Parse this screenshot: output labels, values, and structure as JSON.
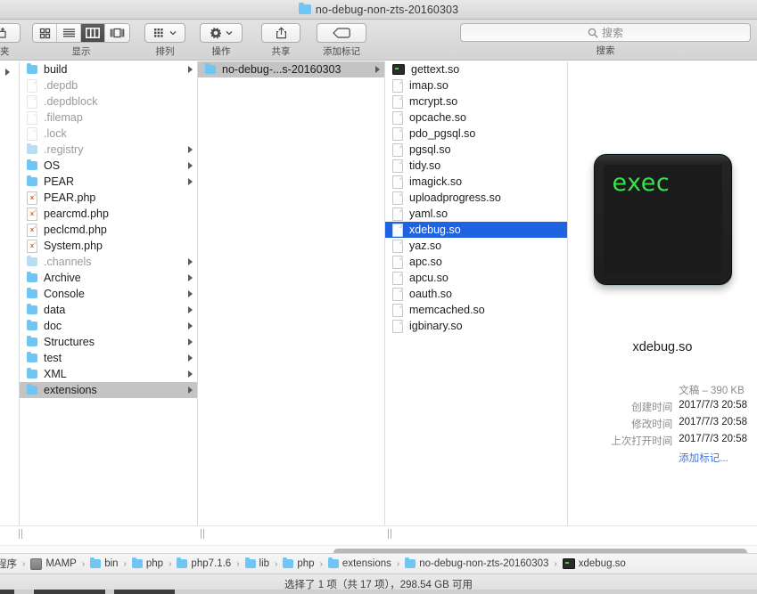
{
  "window": {
    "title": "no-debug-non-zts-20160303",
    "title_icon": "folder-icon"
  },
  "toolbar": {
    "new_folder_label": "件夹",
    "view_label": "显示",
    "arrange_label": "排列",
    "action_label": "操作",
    "share_label": "共享",
    "tags_label": "添加标记",
    "search_label": "搜索",
    "search_placeholder": "搜索",
    "search_value": "",
    "view_modes": [
      "icon-view",
      "list-view",
      "column-view",
      "gallery-view"
    ],
    "active_view_index": 2
  },
  "columns": [
    {
      "name": "column-1",
      "items": [
        {
          "label": "build",
          "icon": "folder-icon",
          "dimmed": false,
          "arrow": true,
          "selected": "none"
        },
        {
          "label": ".depdb",
          "icon": "doc-icon",
          "dimmed": true,
          "arrow": false,
          "selected": "none"
        },
        {
          "label": ".depdblock",
          "icon": "doc-icon",
          "dimmed": true,
          "arrow": false,
          "selected": "none"
        },
        {
          "label": ".filemap",
          "icon": "doc-icon",
          "dimmed": true,
          "arrow": false,
          "selected": "none"
        },
        {
          "label": ".lock",
          "icon": "doc-icon",
          "dimmed": true,
          "arrow": false,
          "selected": "none"
        },
        {
          "label": ".registry",
          "icon": "folder-icon",
          "dimmed": true,
          "arrow": true,
          "selected": "none"
        },
        {
          "label": "OS",
          "icon": "folder-icon",
          "dimmed": false,
          "arrow": true,
          "selected": "none"
        },
        {
          "label": "PEAR",
          "icon": "folder-icon",
          "dimmed": false,
          "arrow": true,
          "selected": "none"
        },
        {
          "label": "PEAR.php",
          "icon": "php-doc-icon",
          "dimmed": false,
          "arrow": false,
          "selected": "none"
        },
        {
          "label": "pearcmd.php",
          "icon": "php-doc-icon",
          "dimmed": false,
          "arrow": false,
          "selected": "none"
        },
        {
          "label": "peclcmd.php",
          "icon": "php-doc-icon",
          "dimmed": false,
          "arrow": false,
          "selected": "none"
        },
        {
          "label": "System.php",
          "icon": "php-doc-icon",
          "dimmed": false,
          "arrow": false,
          "selected": "none"
        },
        {
          "label": ".channels",
          "icon": "folder-icon",
          "dimmed": true,
          "arrow": true,
          "selected": "none"
        },
        {
          "label": "Archive",
          "icon": "folder-icon",
          "dimmed": false,
          "arrow": true,
          "selected": "none"
        },
        {
          "label": "Console",
          "icon": "folder-icon",
          "dimmed": false,
          "arrow": true,
          "selected": "none"
        },
        {
          "label": "data",
          "icon": "folder-icon",
          "dimmed": false,
          "arrow": true,
          "selected": "none"
        },
        {
          "label": "doc",
          "icon": "folder-icon",
          "dimmed": false,
          "arrow": true,
          "selected": "none"
        },
        {
          "label": "Structures",
          "icon": "folder-icon",
          "dimmed": false,
          "arrow": true,
          "selected": "none"
        },
        {
          "label": "test",
          "icon": "folder-icon",
          "dimmed": false,
          "arrow": true,
          "selected": "none"
        },
        {
          "label": "XML",
          "icon": "folder-icon",
          "dimmed": false,
          "arrow": true,
          "selected": "none"
        },
        {
          "label": "extensions",
          "icon": "folder-icon",
          "dimmed": false,
          "arrow": true,
          "selected": "grey"
        }
      ]
    },
    {
      "name": "column-2",
      "items": [
        {
          "label": "no-debug-...s-20160303",
          "icon": "folder-icon",
          "dimmed": false,
          "arrow": true,
          "selected": "grey"
        }
      ]
    },
    {
      "name": "column-3",
      "items": [
        {
          "label": "gettext.so",
          "icon": "exec-icon",
          "dimmed": false,
          "arrow": false,
          "selected": "none"
        },
        {
          "label": "imap.so",
          "icon": "doc-icon",
          "dimmed": false,
          "arrow": false,
          "selected": "none"
        },
        {
          "label": "mcrypt.so",
          "icon": "doc-icon",
          "dimmed": false,
          "arrow": false,
          "selected": "none"
        },
        {
          "label": "opcache.so",
          "icon": "doc-icon",
          "dimmed": false,
          "arrow": false,
          "selected": "none"
        },
        {
          "label": "pdo_pgsql.so",
          "icon": "doc-icon",
          "dimmed": false,
          "arrow": false,
          "selected": "none"
        },
        {
          "label": "pgsql.so",
          "icon": "doc-icon",
          "dimmed": false,
          "arrow": false,
          "selected": "none"
        },
        {
          "label": "tidy.so",
          "icon": "doc-icon",
          "dimmed": false,
          "arrow": false,
          "selected": "none"
        },
        {
          "label": "imagick.so",
          "icon": "doc-icon",
          "dimmed": false,
          "arrow": false,
          "selected": "none"
        },
        {
          "label": "uploadprogress.so",
          "icon": "doc-icon",
          "dimmed": false,
          "arrow": false,
          "selected": "none"
        },
        {
          "label": "yaml.so",
          "icon": "doc-icon",
          "dimmed": false,
          "arrow": false,
          "selected": "none"
        },
        {
          "label": "xdebug.so",
          "icon": "doc-icon",
          "dimmed": false,
          "arrow": false,
          "selected": "blue"
        },
        {
          "label": "yaz.so",
          "icon": "doc-icon",
          "dimmed": false,
          "arrow": false,
          "selected": "none"
        },
        {
          "label": "apc.so",
          "icon": "doc-icon",
          "dimmed": false,
          "arrow": false,
          "selected": "none"
        },
        {
          "label": "apcu.so",
          "icon": "doc-icon",
          "dimmed": false,
          "arrow": false,
          "selected": "none"
        },
        {
          "label": "oauth.so",
          "icon": "doc-icon",
          "dimmed": false,
          "arrow": false,
          "selected": "none"
        },
        {
          "label": "memcached.so",
          "icon": "doc-icon",
          "dimmed": false,
          "arrow": false,
          "selected": "none"
        },
        {
          "label": "igbinary.so",
          "icon": "doc-icon",
          "dimmed": false,
          "arrow": false,
          "selected": "none"
        }
      ]
    }
  ],
  "preview": {
    "icon_name": "exec-terminal-icon",
    "icon_text": "exec",
    "filename": "xdebug.so",
    "kind_size": "文稿 – 390 KB",
    "rows": [
      {
        "key": "创建时间",
        "value": "2017/7/3 20:58"
      },
      {
        "key": "修改时间",
        "value": "2017/7/3 20:58"
      },
      {
        "key": "上次打开时间",
        "value": "2017/7/3 20:58"
      }
    ],
    "add_tags": "添加标记..."
  },
  "pathbar": {
    "crumbs": [
      {
        "label": "应用程序",
        "icon": "none"
      },
      {
        "label": "MAMP",
        "icon": "app-icon"
      },
      {
        "label": "bin",
        "icon": "folder-icon"
      },
      {
        "label": "php",
        "icon": "folder-icon"
      },
      {
        "label": "php7.1.6",
        "icon": "folder-icon"
      },
      {
        "label": "lib",
        "icon": "folder-icon"
      },
      {
        "label": "php",
        "icon": "folder-icon"
      },
      {
        "label": "extensions",
        "icon": "folder-icon"
      },
      {
        "label": "no-debug-non-zts-20160303",
        "icon": "folder-icon"
      },
      {
        "label": "xdebug.so",
        "icon": "exec-icon"
      }
    ]
  },
  "statusbar": {
    "text": "选择了 1 项（共 17 项），298.54 GB 可用"
  },
  "colors": {
    "selection_blue": "#1f63e0",
    "selection_grey": "#c4c4c4",
    "folder_blue": "#6fc6f5",
    "link_blue": "#3c78e8",
    "exec_green": "#38e04f"
  }
}
